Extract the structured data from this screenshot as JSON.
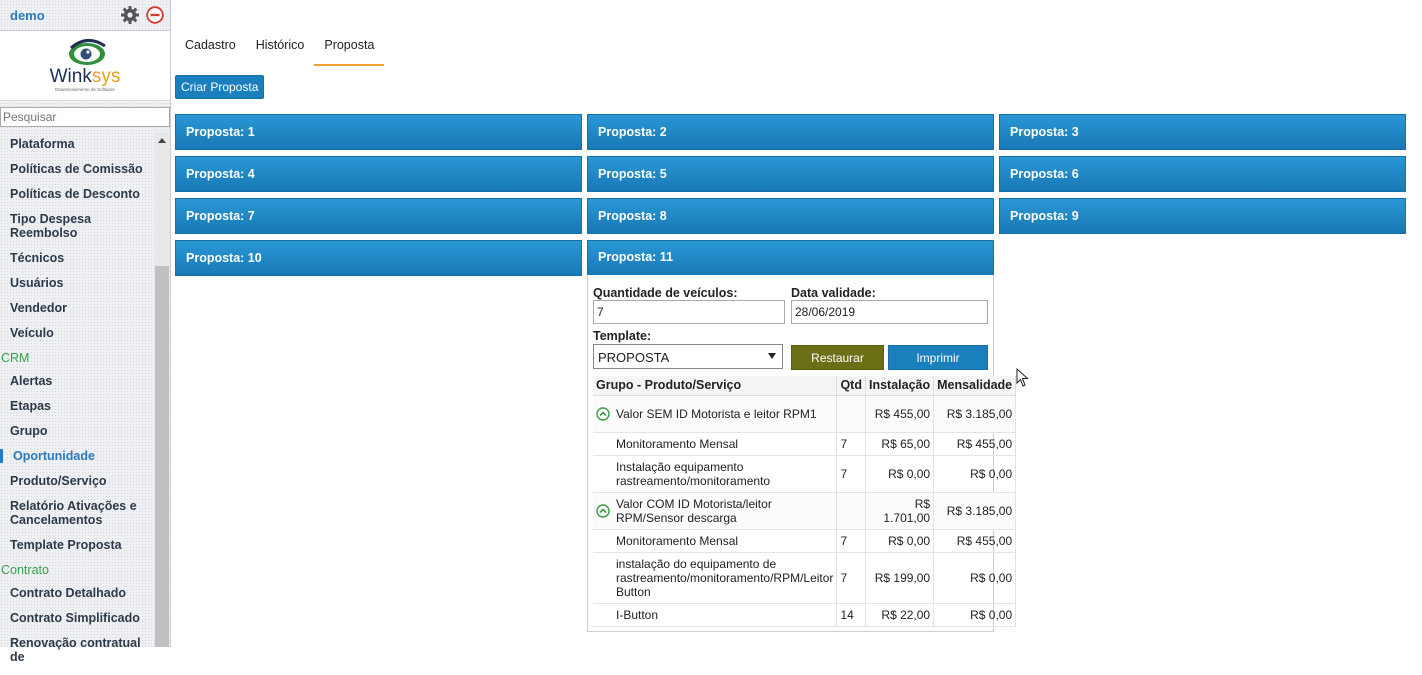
{
  "sidebar": {
    "user": "demo",
    "search_placeholder": "Pesquisar",
    "logo_text": "Winksys",
    "logo_subtext": "Desenvolvimento de Software",
    "items": [
      {
        "label": "Plataforma",
        "type": "item"
      },
      {
        "label": "Políticas de Comissão",
        "type": "item"
      },
      {
        "label": "Políticas de Desconto",
        "type": "item"
      },
      {
        "label": "Tipo Despesa Reembolso",
        "type": "item"
      },
      {
        "label": "Técnicos",
        "type": "item"
      },
      {
        "label": "Usuários",
        "type": "item"
      },
      {
        "label": "Vendedor",
        "type": "item"
      },
      {
        "label": "Veículo",
        "type": "item"
      },
      {
        "label": "CRM",
        "type": "header"
      },
      {
        "label": "Alertas",
        "type": "item"
      },
      {
        "label": "Etapas",
        "type": "item"
      },
      {
        "label": "Grupo",
        "type": "item"
      },
      {
        "label": "Oportunidade",
        "type": "item",
        "active": true
      },
      {
        "label": "Produto/Serviço",
        "type": "item"
      },
      {
        "label": "Relatório Ativações e Cancelamentos",
        "type": "item"
      },
      {
        "label": "Template Proposta",
        "type": "item"
      },
      {
        "label": "Contrato",
        "type": "header"
      },
      {
        "label": "Contrato Detalhado",
        "type": "item"
      },
      {
        "label": "Contrato Simplificado",
        "type": "item"
      },
      {
        "label": "Renovação contratual de",
        "type": "item"
      }
    ]
  },
  "tabs": [
    {
      "label": "Cadastro"
    },
    {
      "label": "Histórico"
    },
    {
      "label": "Proposta",
      "active": true
    }
  ],
  "criar_label": "Criar Proposta",
  "proposals": [
    "Proposta: 1",
    "Proposta: 2",
    "Proposta: 3",
    "Proposta: 4",
    "Proposta: 5",
    "Proposta: 6",
    "Proposta: 7",
    "Proposta: 8",
    "Proposta: 9",
    "Proposta: 10",
    "Proposta: 11"
  ],
  "detail": {
    "qtd_label": "Quantidade de veículos:",
    "qtd_value": "7",
    "data_label": "Data validade:",
    "data_value": "28/06/2019",
    "template_label": "Template:",
    "template_value": "PROPOSTA",
    "restaurar_label": "Restaurar",
    "imprimir_label": "Imprimir",
    "table": {
      "headers": [
        "Grupo - Produto/Serviço",
        "Qtd",
        "Instalação",
        "Mensalidade"
      ],
      "rows": [
        {
          "group": true,
          "name": "Valor SEM ID Motorista e leitor RPM1",
          "qtd": "",
          "inst": "R$ 455,00",
          "mens": "R$ 3.185,00"
        },
        {
          "group": false,
          "name": "Monitoramento Mensal",
          "qtd": "7",
          "inst": "R$ 65,00",
          "mens": "R$ 455,00"
        },
        {
          "group": false,
          "name": "Instalação equipamento rastreamento/monitoramento",
          "qtd": "7",
          "inst": "R$ 0,00",
          "mens": "R$ 0,00"
        },
        {
          "group": true,
          "name": "Valor COM ID Motorista/leitor RPM/Sensor descarga",
          "qtd": "",
          "inst": "R$ 1.701,00",
          "mens": "R$ 3.185,00"
        },
        {
          "group": false,
          "name": "Monitoramento Mensal",
          "qtd": "7",
          "inst": "R$ 0,00",
          "mens": "R$ 455,00"
        },
        {
          "group": false,
          "name": "instalação do equipamento de rastreamento/monitoramento/RPM/Leitor Button",
          "qtd": "7",
          "inst": "R$ 199,00",
          "mens": "R$ 0,00"
        },
        {
          "group": false,
          "name": "I-Button",
          "qtd": "14",
          "inst": "R$ 22,00",
          "mens": "R$ 0,00"
        }
      ]
    }
  }
}
